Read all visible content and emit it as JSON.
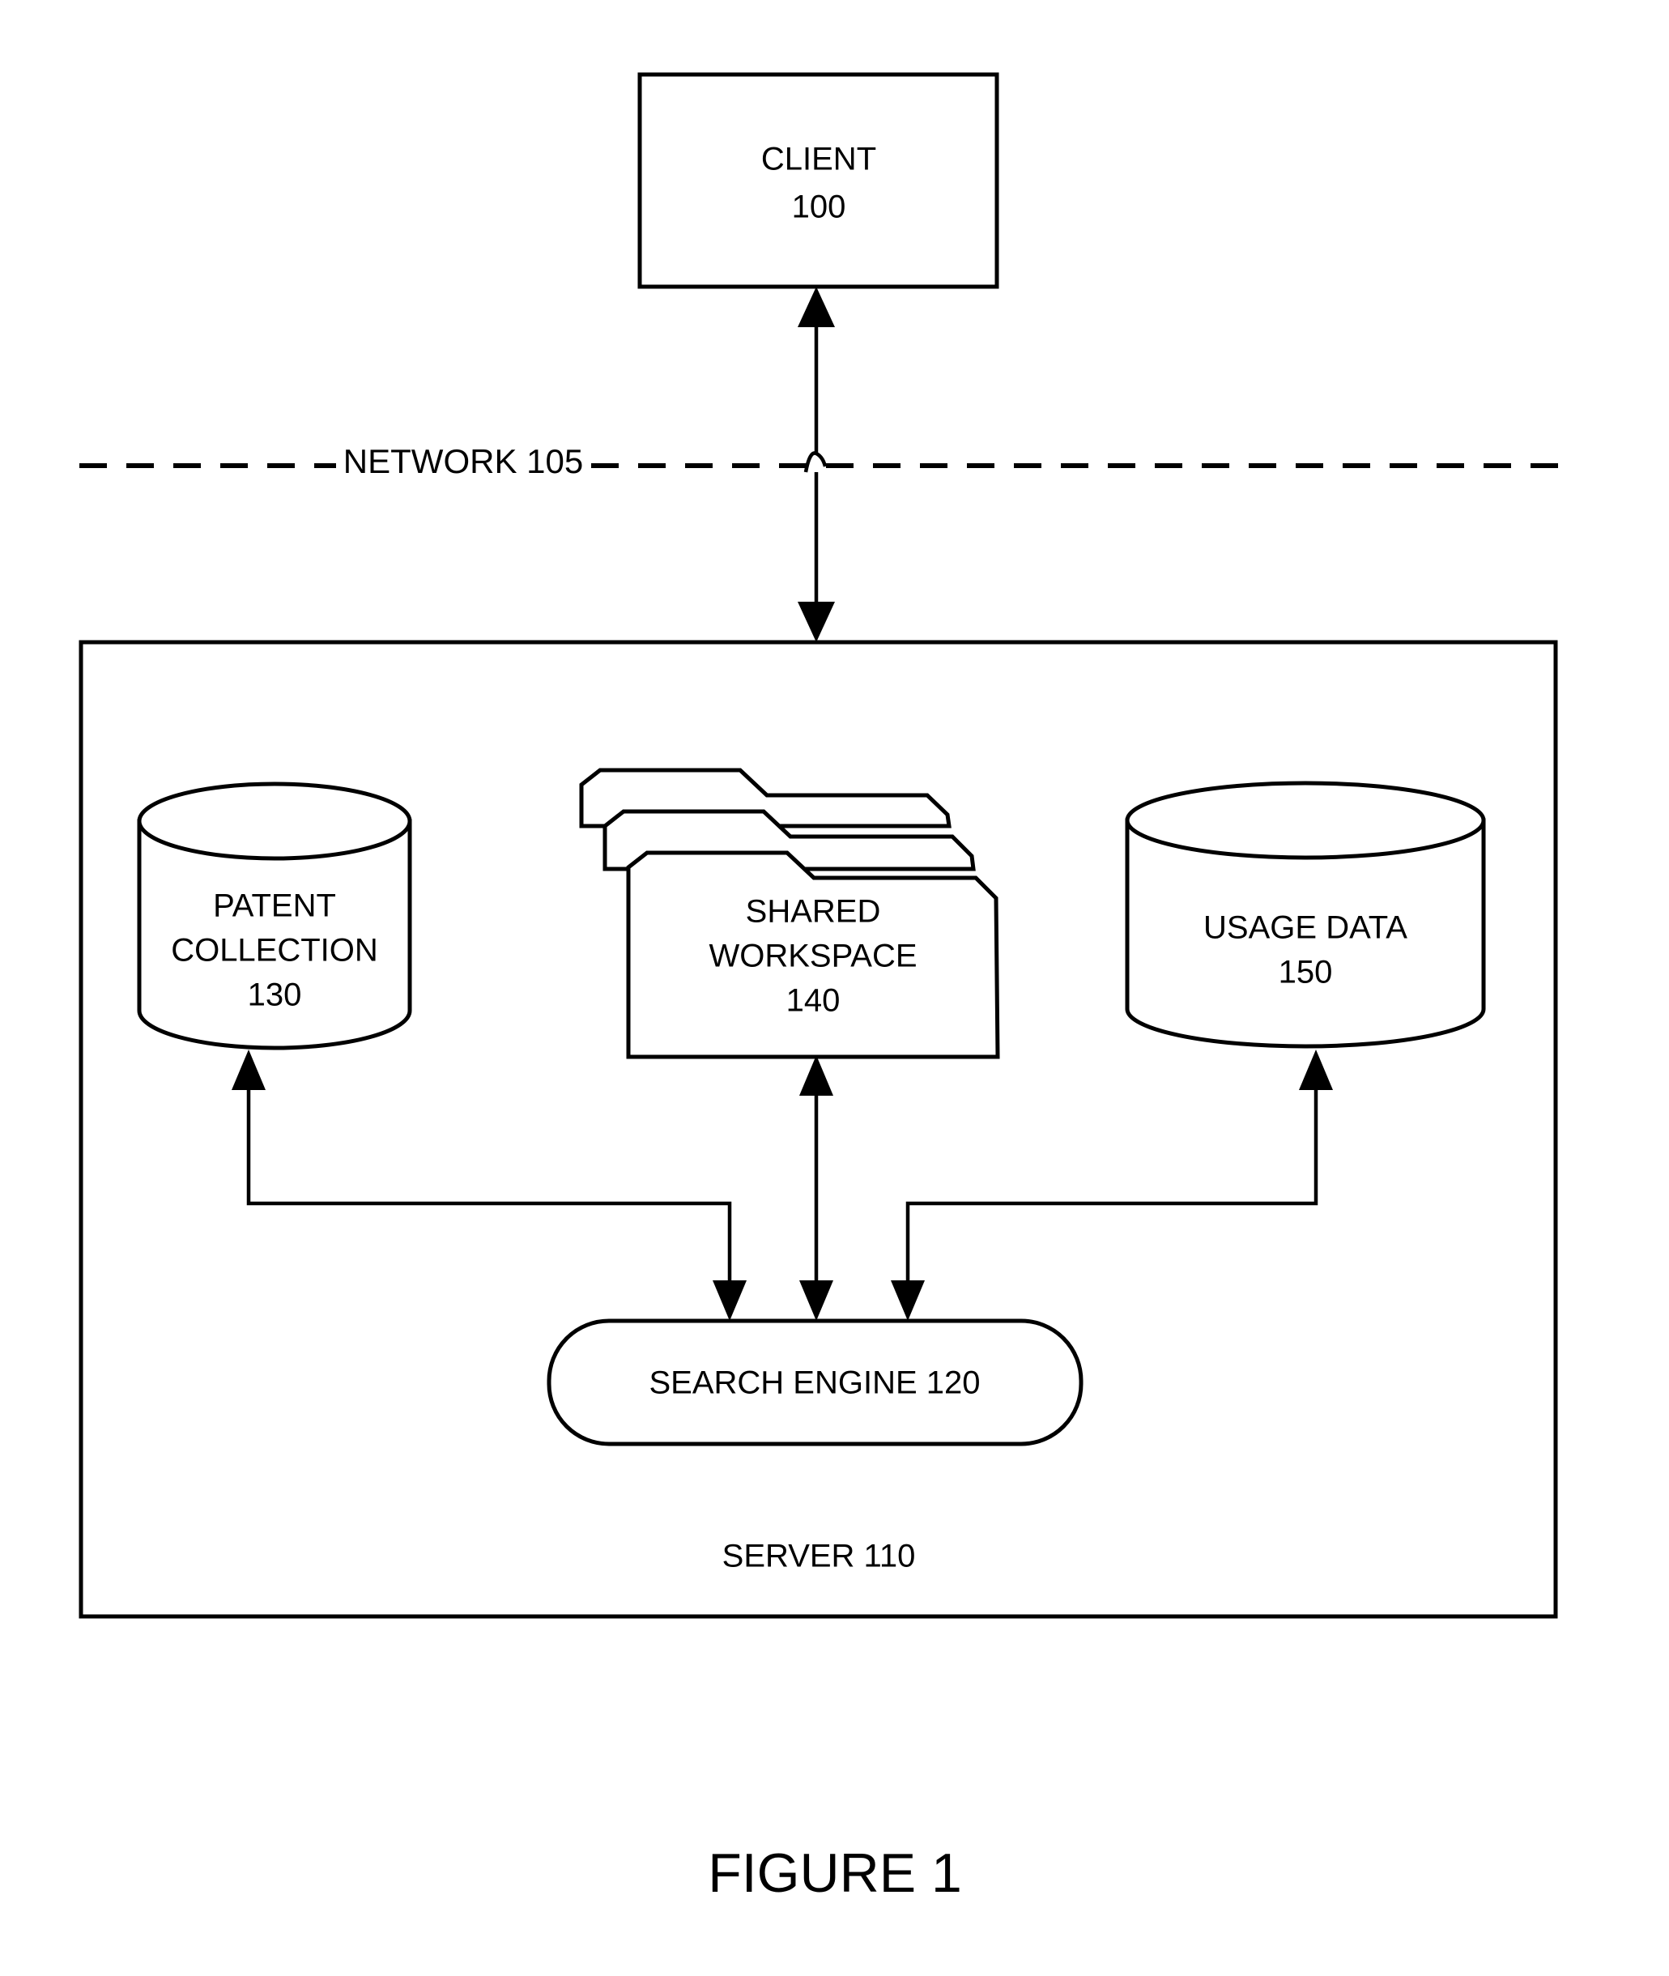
{
  "figure": {
    "caption": "FIGURE 1"
  },
  "nodes": {
    "client": {
      "title": "CLIENT",
      "ref": "100"
    },
    "network": {
      "label": "NETWORK 105"
    },
    "server": {
      "label": "SERVER 110"
    },
    "patent_collection": {
      "line1": "PATENT",
      "line2": "COLLECTION",
      "ref": "130"
    },
    "shared_workspace": {
      "line1": "SHARED",
      "line2": "WORKSPACE",
      "ref": "140"
    },
    "usage_data": {
      "line1": "USAGE DATA",
      "ref": "150"
    },
    "search_engine": {
      "label": "SEARCH ENGINE 120"
    }
  },
  "connectors": [
    {
      "name": "client-to-server",
      "type": "double-arrow",
      "from": "client",
      "to": "server"
    },
    {
      "name": "patent-collection-to-search-engine",
      "type": "arrow-both-ends",
      "from": "patent_collection",
      "to": "search_engine"
    },
    {
      "name": "shared-workspace-to-search-engine",
      "type": "double-arrow",
      "from": "shared_workspace",
      "to": "search_engine"
    },
    {
      "name": "usage-data-to-search-engine",
      "type": "arrow-both-ends",
      "from": "usage_data",
      "to": "search_engine"
    }
  ],
  "colors": {
    "stroke": "#000000",
    "background": "#ffffff"
  }
}
